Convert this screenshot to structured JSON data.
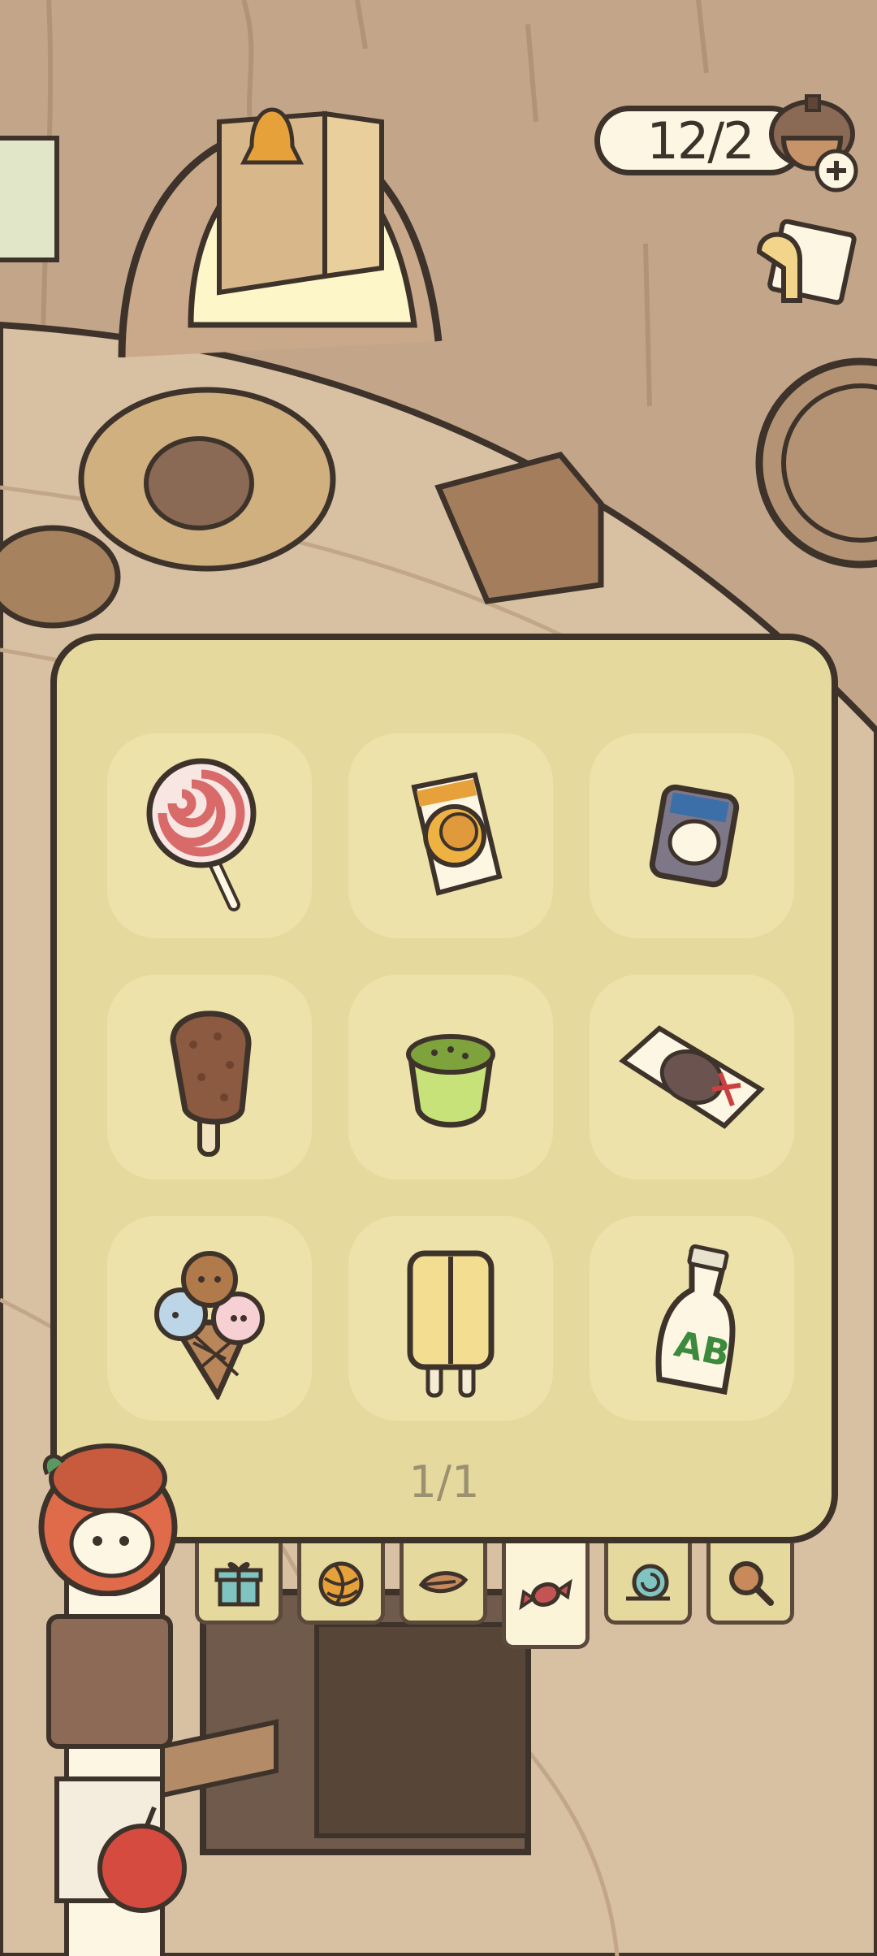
{
  "hud": {
    "acorn_count": "12/2",
    "acorn_plus_icon": "acorn-plus-icon",
    "memo_icon": "memo-hand-icon"
  },
  "inventory": {
    "page_indicator": "1/1",
    "items": [
      {
        "name": "lollipop"
      },
      {
        "name": "wrapped-candy"
      },
      {
        "name": "pudding-jar"
      },
      {
        "name": "chocolate-ice-pop"
      },
      {
        "name": "matcha-cup"
      },
      {
        "name": "chocolate-bar-pack"
      },
      {
        "name": "animal-ice-cream-cone"
      },
      {
        "name": "twin-popsicle"
      },
      {
        "name": "ab-milk-bottle"
      }
    ]
  },
  "tabs": [
    {
      "icon": "gift-icon",
      "active": false
    },
    {
      "icon": "yarn-ball-icon",
      "active": false
    },
    {
      "icon": "leaf-icon",
      "active": false
    },
    {
      "icon": "candy-icon",
      "active": true
    },
    {
      "icon": "snail-shell-icon",
      "active": false
    },
    {
      "icon": "magnifier-icon",
      "active": false
    }
  ],
  "colors": {
    "panel_bg": "#e5d99d",
    "slot_bg": "#ede3aa",
    "outline": "#3e332b",
    "wall": "#c3a68a",
    "active_tab": "#fbf4d9"
  }
}
